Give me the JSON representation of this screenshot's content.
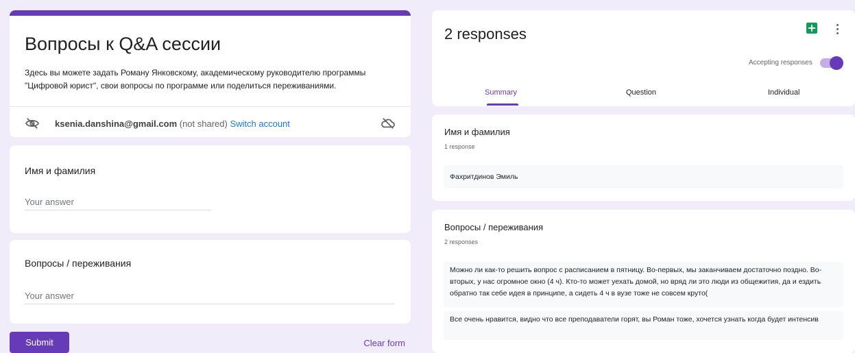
{
  "form": {
    "title": "Вопросы к Q&A сессии",
    "description": "Здесь вы можете задать Роману Янковскому, академическому руководителю программы \"Цифровой юрист\", свои вопросы по программе или поделиться переживаниями.",
    "account_email": "ksenia.danshina@gmail.com",
    "not_shared": " (not shared) ",
    "switch_account": "Switch account",
    "questions": [
      {
        "label": "Имя и фамилия",
        "placeholder": "Your answer"
      },
      {
        "label": "Вопросы / переживания",
        "placeholder": "Your answer"
      }
    ],
    "submit_label": "Submit",
    "clear_label": "Clear form",
    "accent_color": "#673ab7"
  },
  "responses": {
    "count_label": "2 responses",
    "accepting_label": "Accepting responses",
    "accepting": true,
    "tabs": [
      "Summary",
      "Question",
      "Individual"
    ],
    "active_tab": "Summary",
    "questions": [
      {
        "label": "Имя и фамилия",
        "count": "1 response",
        "answers": [
          "Фахритдинов Эмиль"
        ]
      },
      {
        "label": "Вопросы / переживания",
        "count": "2 responses",
        "answers": [
          "Можно ли как-то решить вопрос с расписанием в пятницу. Во-первых, мы заканчиваем достаточно поздно. Во-вторых, у нас огромное окно (4 ч). Кто-то может уехать домой, но вряд ли это люди из общежития, да и ездить обратно так себе идея в принципе, а сидеть 4 ч в вузе тоже не совсем круто(",
          "Все очень нравится, видно что все преподаватели горят, вы Роман тоже, хочется узнать когда будет интенсив"
        ]
      }
    ]
  },
  "icons": {
    "hidden": "eye-off-icon",
    "cloud": "cloud-icon",
    "sheets": "google-sheets-icon",
    "more": "more-vert-icon"
  }
}
